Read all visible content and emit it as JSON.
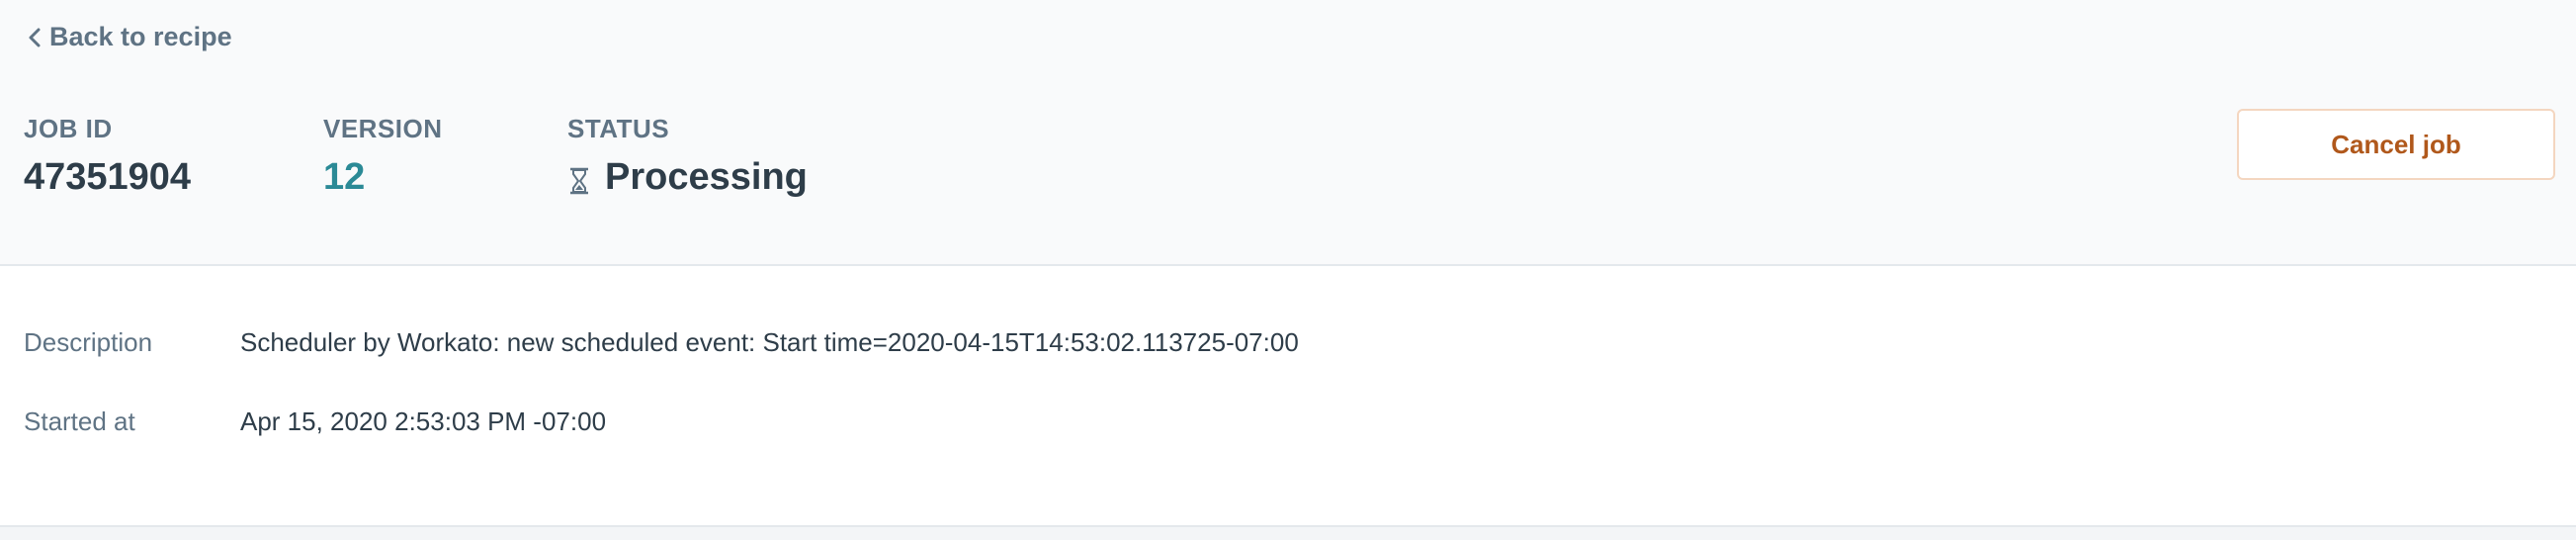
{
  "header": {
    "back_label": "Back to recipe",
    "job_id_label": "JOB ID",
    "job_id_value": "47351904",
    "version_label": "VERSION",
    "version_value": "12",
    "status_label": "STATUS",
    "status_value": "Processing",
    "status_icon": "hourglass-icon",
    "cancel_label": "Cancel job"
  },
  "details": {
    "description_label": "Description",
    "description_value": "Scheduler by Workato: new scheduled event: Start time=2020-04-15T14:53:02.113725-07:00",
    "started_label": "Started at",
    "started_value": "Apr 15, 2020 2:53:03 PM -07:00"
  },
  "colors": {
    "accent_link": "#2b8a96",
    "cancel_text": "#b0581b",
    "cancel_border": "#f4d6c0",
    "muted_text": "#5f7384",
    "primary_text": "#2e3d49"
  }
}
